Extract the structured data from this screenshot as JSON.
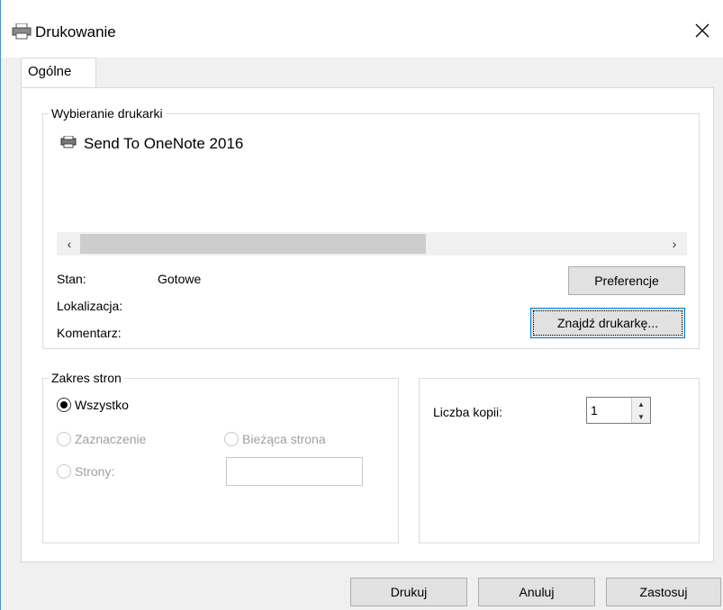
{
  "window": {
    "title": "Drukowanie"
  },
  "tabs": [
    {
      "label": "Ogólne"
    }
  ],
  "printer_group": {
    "title": "Wybieranie drukarki",
    "printers": [
      {
        "name": "Send To OneNote 2016"
      }
    ]
  },
  "status": {
    "stan_label": "Stan:",
    "stan_value": "Gotowe",
    "lokalizacja_label": "Lokalizacja:",
    "komentarz_label": "Komentarz:",
    "preferences_button": "Preferencje",
    "find_printer_button": "Znajdź drukarkę..."
  },
  "page_range": {
    "title": "Zakres stron",
    "all": "Wszystko",
    "selection": "Zaznaczenie",
    "current": "Bieżąca strona",
    "pages": "Strony:",
    "pages_value": "",
    "selected_option": "Wszystko"
  },
  "copies": {
    "label": "Liczba kopii:",
    "value": "1"
  },
  "footer": {
    "print": "Drukuj",
    "cancel": "Anuluj",
    "apply": "Zastosuj"
  },
  "colors": {
    "accent": "#0078d7",
    "window_border": "#4a90d9"
  }
}
